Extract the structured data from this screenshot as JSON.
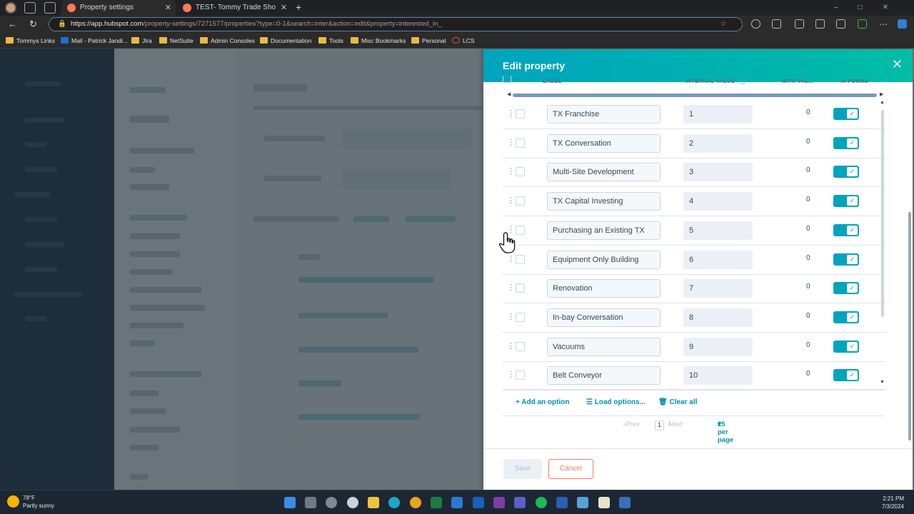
{
  "browser": {
    "tabs": [
      {
        "title": "Property settings"
      },
      {
        "title": "TEST- Tommy Trade Show Lead F"
      }
    ],
    "url_host": "https://app.hubspot.com",
    "url_path": "/property-settings/7271577/properties?type=0-1&search=inter&action=edit&property=interested_in_",
    "bookmarks": [
      "Tommys Links",
      "Mail - Patrick Jandi...",
      "Jira",
      "NetSuite",
      "Admin Consoles",
      "Documentation",
      "Tools",
      "Misc Bookmarks",
      "Personal",
      "LCS"
    ]
  },
  "panel": {
    "title": "Edit property",
    "columns": {
      "label": "LABEL",
      "internal_value": "INTERNAL VALUE",
      "with_values": "WITH VAL...",
      "in_forms": "IN FORMS"
    },
    "options": [
      {
        "label": "TX Franchise",
        "internal_value": "1",
        "with_values": "0",
        "in_forms": true
      },
      {
        "label": "TX Conversation",
        "internal_value": "2",
        "with_values": "0",
        "in_forms": true
      },
      {
        "label": "Multi-Site Development",
        "internal_value": "3",
        "with_values": "0",
        "in_forms": true
      },
      {
        "label": "TX Capital Investing",
        "internal_value": "4",
        "with_values": "0",
        "in_forms": true
      },
      {
        "label": "Purchasing an Existing TX",
        "internal_value": "5",
        "with_values": "0",
        "in_forms": true
      },
      {
        "label": "Equipment Only Building",
        "internal_value": "6",
        "with_values": "0",
        "in_forms": true
      },
      {
        "label": "Renovation",
        "internal_value": "7",
        "with_values": "0",
        "in_forms": true
      },
      {
        "label": "In-bay Conversation",
        "internal_value": "8",
        "with_values": "0",
        "in_forms": true
      },
      {
        "label": "Vacuums",
        "internal_value": "9",
        "with_values": "0",
        "in_forms": true
      },
      {
        "label": "Belt Conveyor",
        "internal_value": "10",
        "with_values": "0",
        "in_forms": true
      }
    ],
    "actions": {
      "add": "Add an option",
      "load": "Load options...",
      "clear": "Clear all"
    },
    "pagination": {
      "prev": "Prev",
      "current": "1",
      "next": "Next",
      "per_page": "25 per page"
    },
    "buttons": {
      "save": "Save",
      "cancel": "Cancel"
    }
  },
  "taskbar": {
    "temperature": "78°F",
    "weather": "Partly sunny",
    "time": "2:21 PM",
    "date": "7/3/2024"
  },
  "colors": {
    "header_start": "#00a4bd",
    "header_end": "#00bda5",
    "toggle": "#00a4bd",
    "cancel": "#ff7a59",
    "link": "#0091ae"
  }
}
